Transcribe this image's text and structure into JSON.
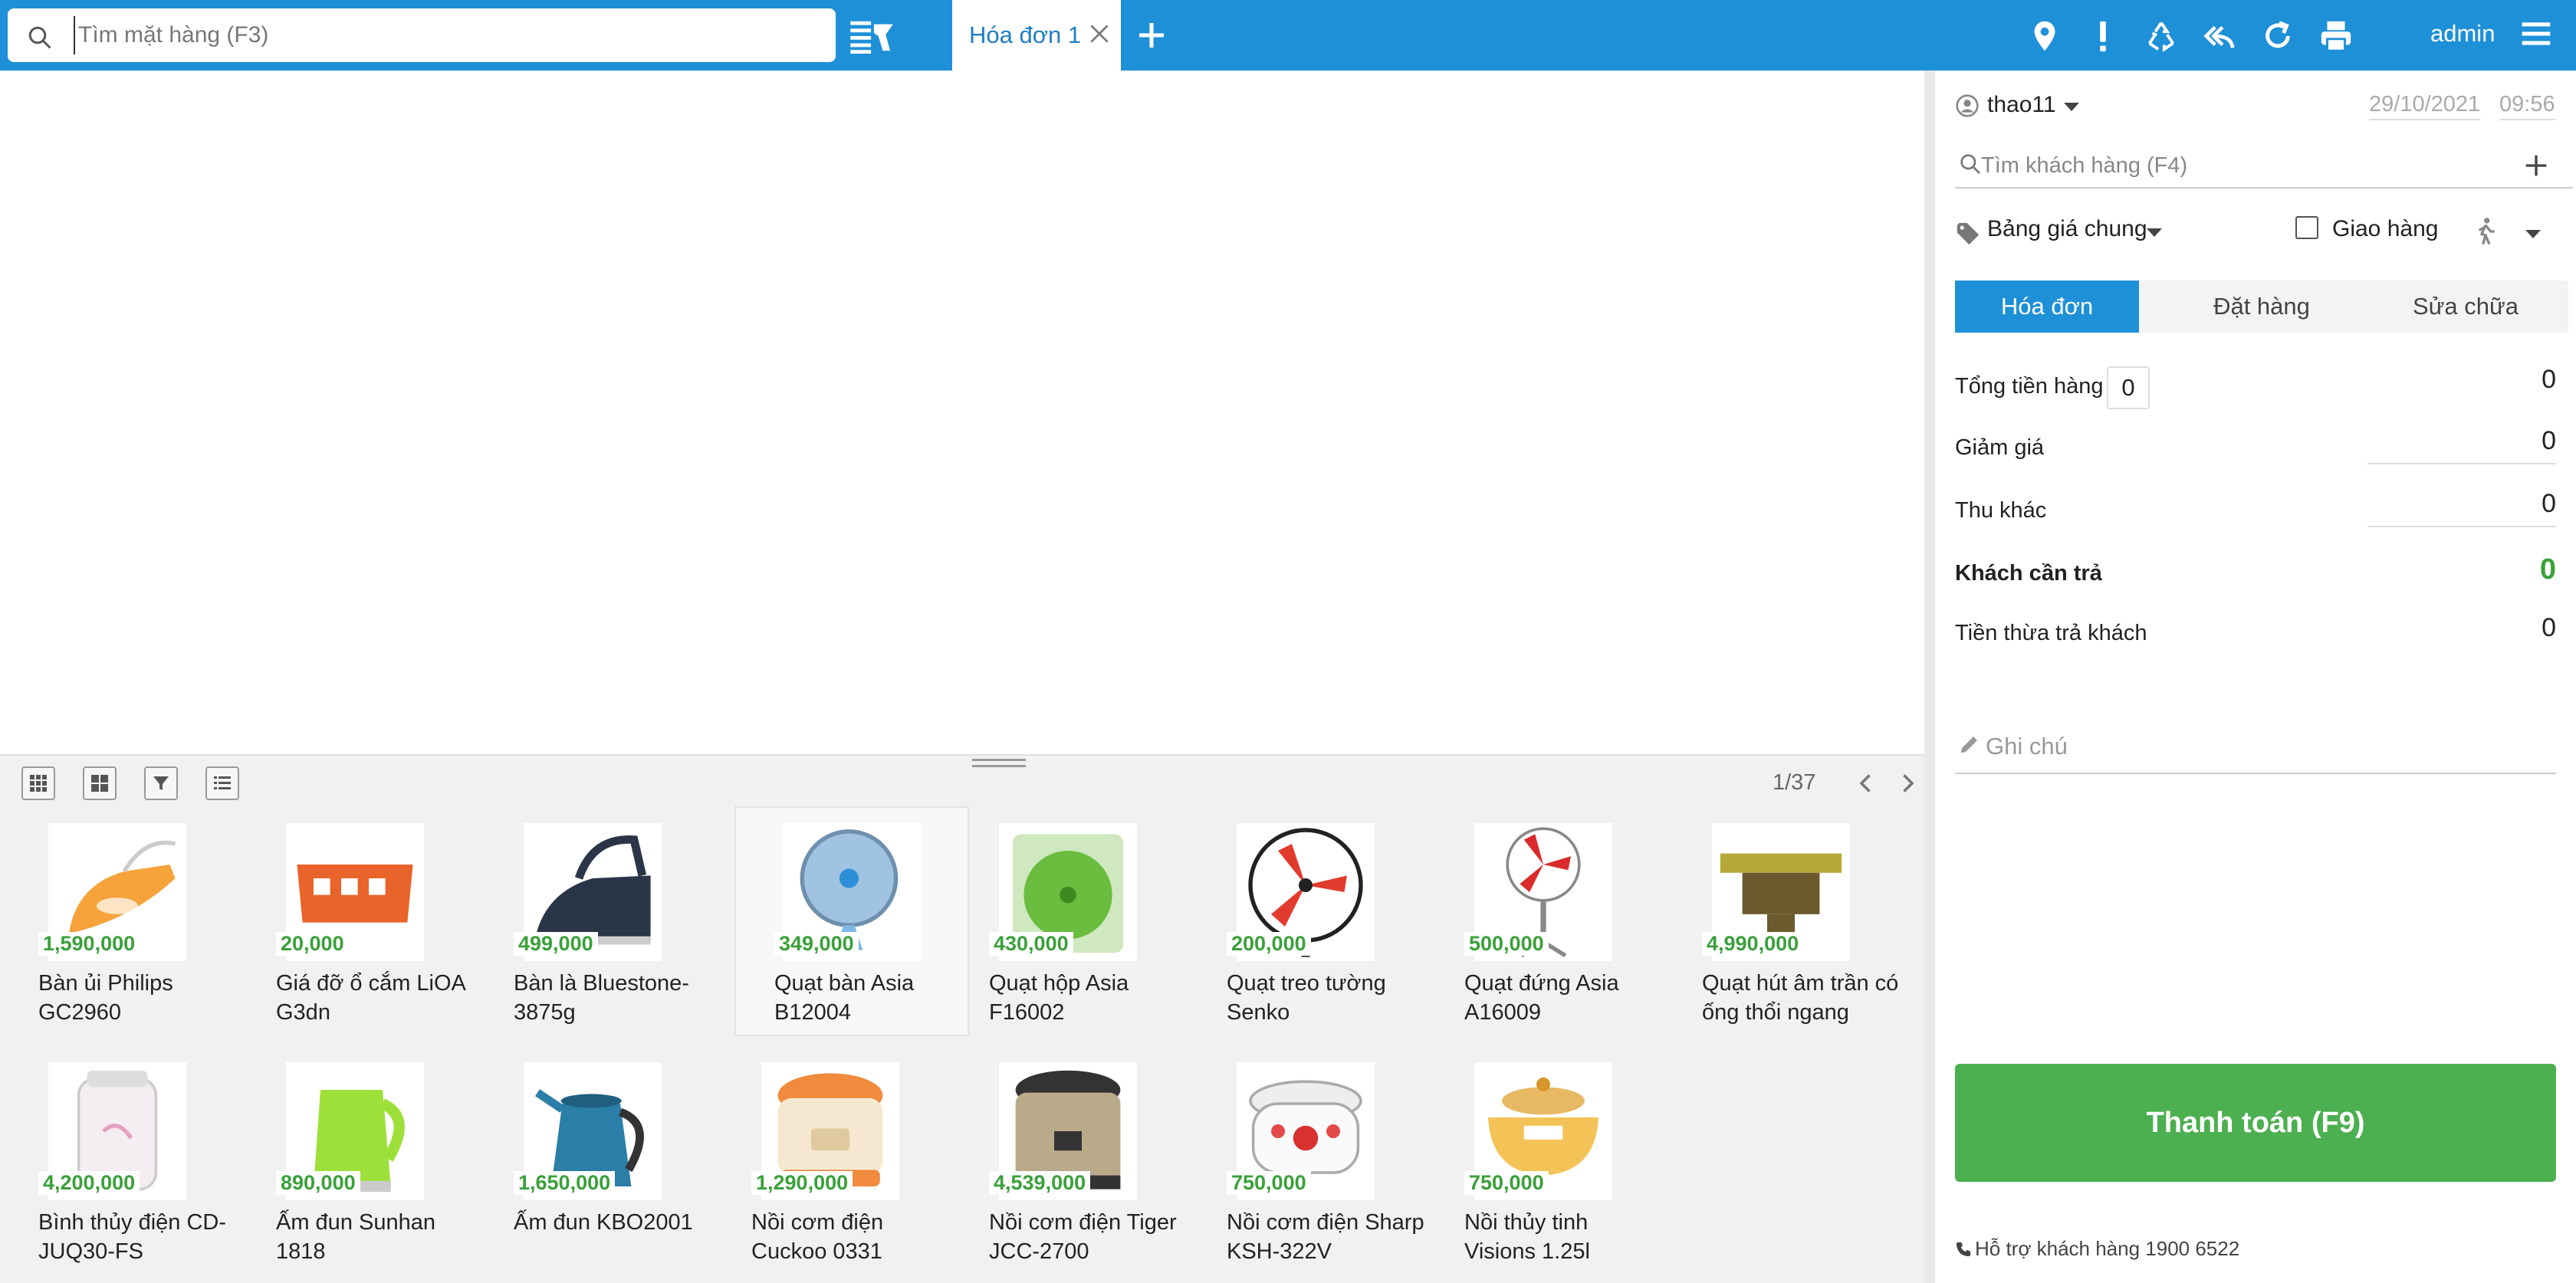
{
  "header": {
    "search_placeholder": "Tìm mặt hàng (F3)",
    "tab_label": "Hóa đơn 1",
    "user": "admin"
  },
  "products": {
    "page_info": "1/37",
    "items": [
      {
        "price": "1,590,000",
        "name": "Bàn ủi Philips GC2960"
      },
      {
        "price": "20,000",
        "name": "Giá đỡ ổ cắm LiOA G3dn"
      },
      {
        "price": "499,000",
        "name": "Bàn là Bluestone-3875g"
      },
      {
        "price": "349,000",
        "name": "Quạt bàn Asia B12004"
      },
      {
        "price": "430,000",
        "name": "Quạt hộp Asia F16002"
      },
      {
        "price": "200,000",
        "name": "Quạt treo tường Senko"
      },
      {
        "price": "500,000",
        "name": "Quạt đứng Asia A16009"
      },
      {
        "price": "4,990,000",
        "name": "Quạt hút âm trần có ống thổi ngang LiO…"
      },
      {
        "price": "4,200,000",
        "name": "Bình thủy điện CD-JUQ30-FS"
      },
      {
        "price": "890,000",
        "name": "Ấm đun Sunhan 1818"
      },
      {
        "price": "1,650,000",
        "name": "Ấm đun KBO2001"
      },
      {
        "price": "1,290,000",
        "name": "Nồi cơm điện Cuckoo 0331"
      },
      {
        "price": "4,539,000",
        "name": "Nồi cơm điện Tiger JCC-2700"
      },
      {
        "price": "750,000",
        "name": "Nồi cơm điện Sharp KSH-322V"
      },
      {
        "price": "750,000",
        "name": "Nồi thủy tinh Visions 1.25l"
      }
    ]
  },
  "order": {
    "seller": "thao11",
    "date": "29/10/2021",
    "time": "09:56",
    "customer_placeholder": "Tìm khách hàng (F4)",
    "pricebook": "Bảng giá chung",
    "delivery_label": "Giao hàng",
    "tabs": [
      "Hóa đơn",
      "Đặt hàng",
      "Sửa chữa"
    ],
    "total_label": "Tổng tiền hàng",
    "total_qty": "0",
    "total_value": "0",
    "discount_label": "Giảm giá",
    "discount_value": "0",
    "other_label": "Thu khác",
    "other_value": "0",
    "payable_label": "Khách cần trả",
    "payable_value": "0",
    "change_label": "Tiền thừa trả khách",
    "change_value": "0",
    "note_placeholder": "Ghi chú",
    "pay_button": "Thanh toán (F9)",
    "support": "Hỗ trợ khách hàng 1900 6522"
  },
  "colors": {
    "primary": "#1e90d8",
    "pay": "#4caf50",
    "price": "#3aa03a"
  }
}
